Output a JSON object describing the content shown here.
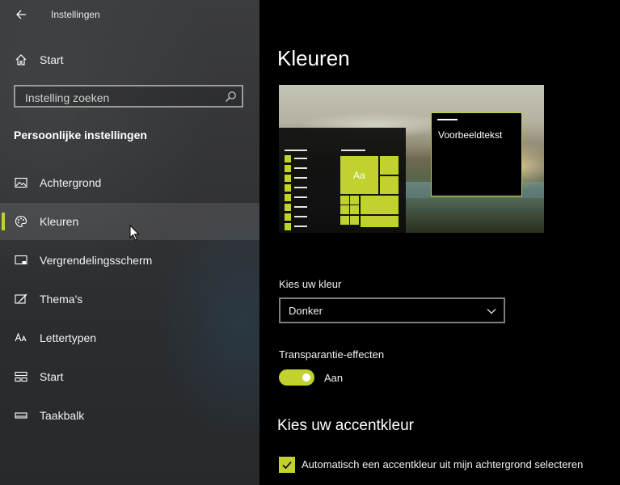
{
  "app": {
    "title": "Instellingen"
  },
  "sidebar": {
    "home_label": "Start",
    "search_placeholder": "Instelling zoeken",
    "section_heading": "Persoonlijke instellingen",
    "items": [
      {
        "label": "Achtergrond",
        "icon": "image-icon"
      },
      {
        "label": "Kleuren",
        "icon": "palette-icon",
        "selected": true
      },
      {
        "label": "Vergrendelingsscherm",
        "icon": "lock-screen-icon"
      },
      {
        "label": "Thema's",
        "icon": "theme-brush-icon"
      },
      {
        "label": "Lettertypen",
        "icon": "font-icon"
      },
      {
        "label": "Start",
        "icon": "start-icon"
      },
      {
        "label": "Taakbalk",
        "icon": "taskbar-icon"
      }
    ]
  },
  "main": {
    "title": "Kleuren",
    "preview": {
      "sample_text": "Voorbeeldtekst",
      "tile_text": "Aa"
    },
    "choose_color": {
      "label": "Kies uw kleur",
      "value": "Donker"
    },
    "transparency": {
      "label": "Transparantie-effecten",
      "state_label": "Aan",
      "on": true
    },
    "accent_heading": "Kies uw accentkleur",
    "auto_accent": {
      "label": "Automatisch een accentkleur uit mijn achtergrond selecteren",
      "checked": true
    }
  },
  "colors": {
    "accent": "#c1d22f",
    "sidebar_bg": "#333436",
    "main_bg": "#000000"
  }
}
